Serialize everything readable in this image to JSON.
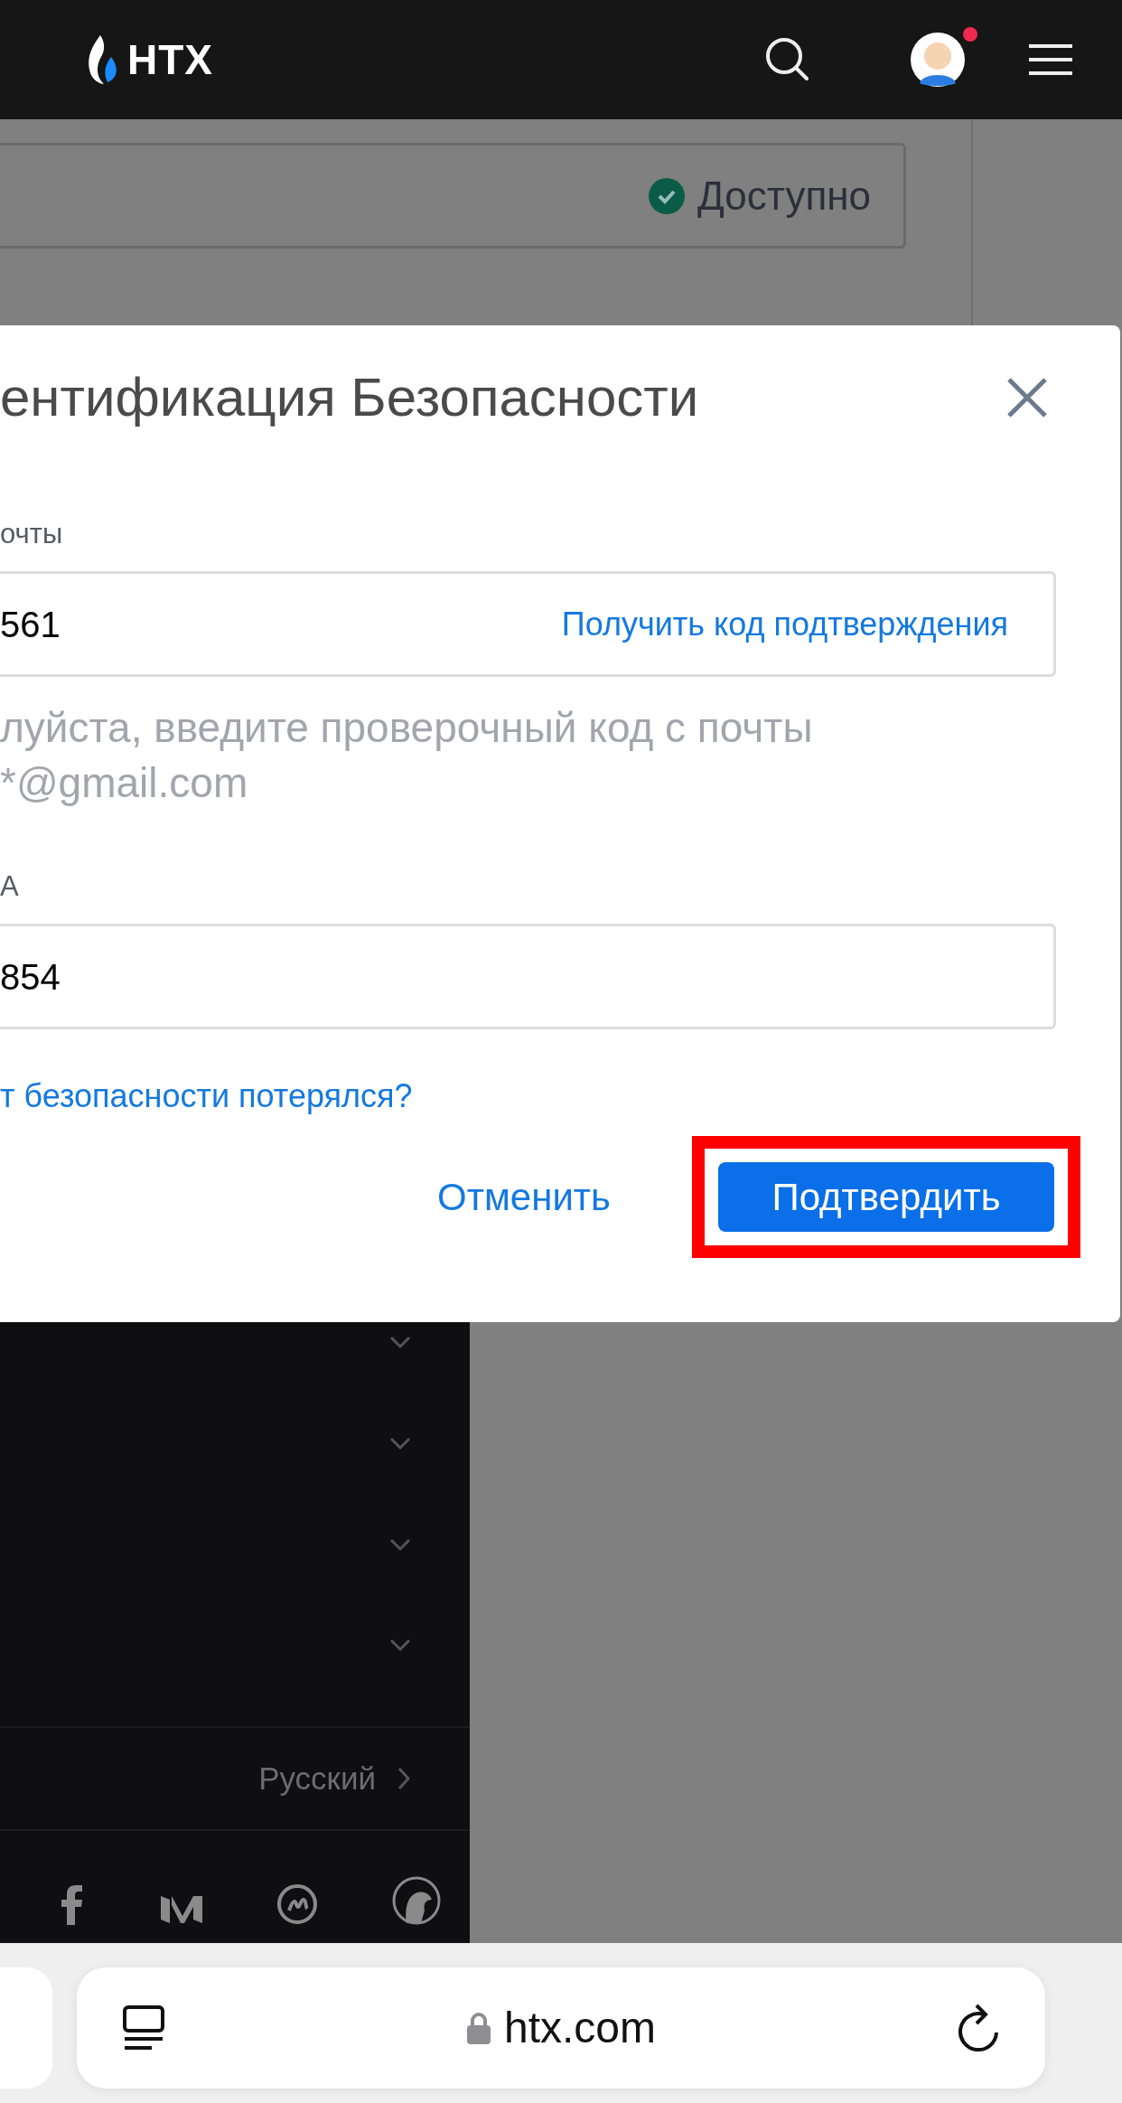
{
  "header": {
    "logo": "HTX",
    "notification_dot": true
  },
  "background": {
    "status": "Доступно"
  },
  "dialog": {
    "title": "ентификация Безопасности",
    "email_label": "очты",
    "email_code": "561",
    "get_code_link": "Получить код подтверждения",
    "hint_lines": [
      "луйста, введите проверочный код с почты",
      "*@gmail.com"
    ],
    "ga_label": "A",
    "ga_code": "854",
    "lost_link": "т безопасности потерялся?",
    "cancel": "Отменить",
    "confirm": "Подтвердить",
    "confirm_highlighted": true
  },
  "sidebar": {
    "language": "Русский"
  },
  "browser": {
    "url": "htx.com"
  }
}
